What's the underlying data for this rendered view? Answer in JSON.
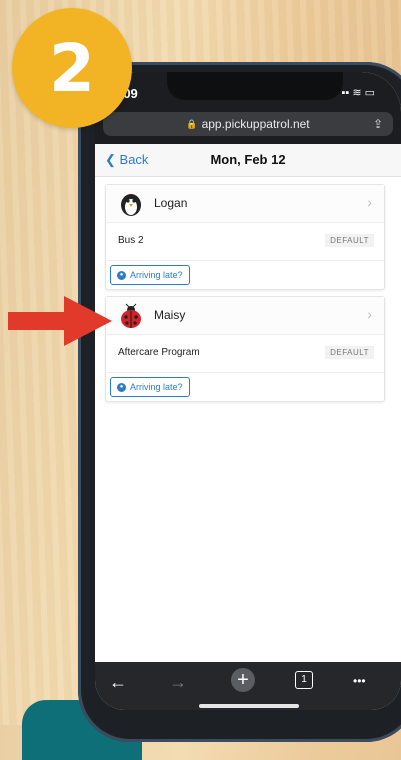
{
  "badge": {
    "number": "2"
  },
  "status": {
    "time": ":09",
    "icons": "▪▪ ≋ ▭"
  },
  "browser": {
    "url": "app.pickuppatrol.net",
    "lock": "🔒",
    "share_icon": "share-icon"
  },
  "nav": {
    "back_label": "Back",
    "title": "Mon, Feb 12"
  },
  "students": [
    {
      "name": "Logan",
      "route": "Bus 2",
      "route_tag": "DEFAULT",
      "late_label": "Arriving late?",
      "avatar_icon": "penguin-icon"
    },
    {
      "name": "Maisy",
      "route": "Aftercare Program",
      "route_tag": "DEFAULT",
      "late_label": "Arriving late?",
      "avatar_icon": "ladybug-icon"
    }
  ],
  "toolbar": {
    "back": "←",
    "forward": "→",
    "new_tab": "+",
    "tabs": "1",
    "more": "•••"
  },
  "colors": {
    "accent": "#2d7cc9",
    "badge": "#f2b424",
    "arrow": "#e23a2a"
  }
}
